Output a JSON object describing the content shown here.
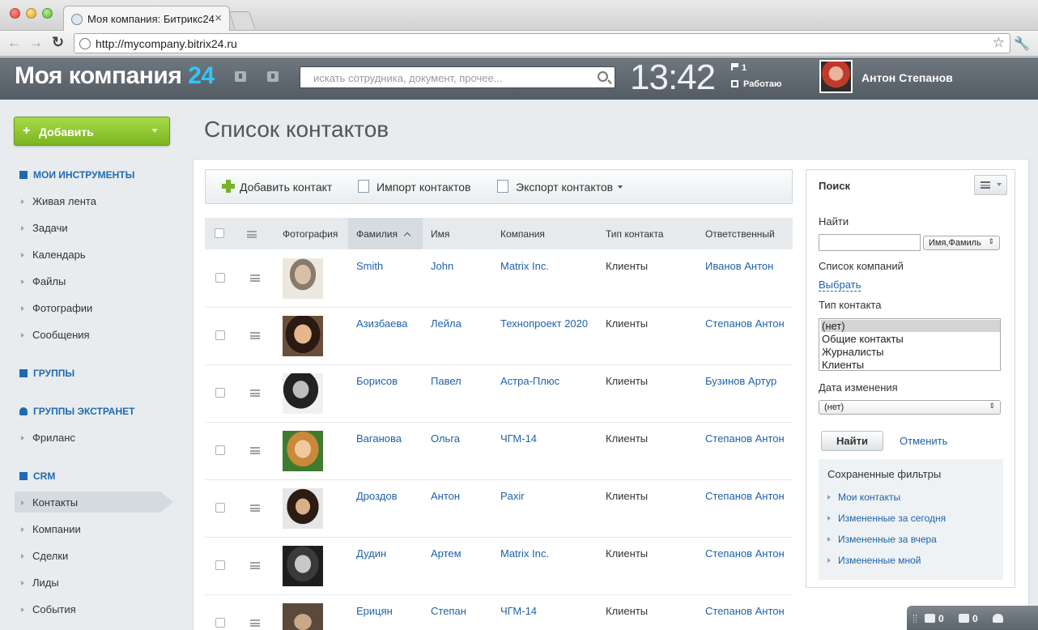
{
  "browser": {
    "tab_title": "Моя компания: Битрикс24",
    "tab_close": "×",
    "url": "http://mycompany.bitrix24.ru",
    "back": "←",
    "forward": "→",
    "reload": "↻",
    "star": "☆",
    "wrench": "🔧"
  },
  "header": {
    "logo_text": "Моя компания",
    "logo_accent": "24",
    "search_placeholder": "искать сотрудника, документ, прочее...",
    "clock": "13:42",
    "flag_count": "1",
    "status": "Работаю",
    "user_name": "Антон Степанов",
    "accent_color": "#2fc7f7"
  },
  "sidebar": {
    "add_plus": "+",
    "add_label": "Добавить",
    "sections": [
      {
        "title": "МОИ ИНСТРУМЕНТЫ",
        "items": [
          "Живая лента",
          "Задачи",
          "Календарь",
          "Файлы",
          "Фотографии",
          "Сообщения"
        ]
      },
      {
        "title": "ГРУППЫ",
        "items": []
      },
      {
        "title": "ГРУППЫ ЭКСТРАНЕТ",
        "items": [
          "Фриланс"
        ]
      },
      {
        "title": "CRM",
        "items": [
          "Контакты",
          "Компании",
          "Сделки",
          "Лиды",
          "События"
        ]
      }
    ],
    "active_item": "Контакты"
  },
  "main": {
    "title": "Список контактов",
    "toolbar": {
      "add_contact": "Добавить контакт",
      "import_contacts": "Импорт контактов",
      "export_contacts": "Экспорт контактов"
    },
    "columns": [
      "Фотография",
      "Фамилия",
      "Имя",
      "Компания",
      "Тип контакта",
      "Ответственный"
    ],
    "rows": [
      {
        "last": "Smith",
        "first": "John",
        "company": "Matrix Inc.",
        "type": "Клиенты",
        "owner": "Иванов Антон"
      },
      {
        "last": "Азизбаева",
        "first": "Лейла",
        "company": "Технопроект 2020",
        "type": "Клиенты",
        "owner": "Степанов Антон"
      },
      {
        "last": "Борисов",
        "first": "Павел",
        "company": "Астра-Плюс",
        "type": "Клиенты",
        "owner": "Бузинов Артур"
      },
      {
        "last": "Ваганова",
        "first": "Ольга",
        "company": "ЧГМ-14",
        "type": "Клиенты",
        "owner": "Степанов Антон"
      },
      {
        "last": "Дроздов",
        "first": "Антон",
        "company": "Paxir",
        "type": "Клиенты",
        "owner": "Степанов Антон"
      },
      {
        "last": "Дудин",
        "first": "Артем",
        "company": "Matrix Inc.",
        "type": "Клиенты",
        "owner": "Степанов Антон"
      },
      {
        "last": "Ерицян",
        "first": "Степан",
        "company": "ЧГМ-14",
        "type": "Клиенты",
        "owner": "Степанов Антон"
      }
    ]
  },
  "filter": {
    "title": "Поиск",
    "find_label": "Найти",
    "find_field_select": "Имя,Фамиль",
    "companies_label": "Список компаний",
    "choose_link": "Выбрать",
    "contact_type_label": "Тип контакта",
    "contact_type_options": [
      "(нет)",
      "Общие контакты",
      "Журналисты",
      "Клиенты"
    ],
    "date_label": "Дата изменения",
    "date_select": "(нет)",
    "find_button": "Найти",
    "cancel_link": "Отменить",
    "saved_title": "Сохраненные фильтры",
    "saved_items": [
      "Мои контакты",
      "Измененные за сегодня",
      "Измененные за вчера",
      "Измененные мной"
    ]
  },
  "bottom_bar": {
    "messages": "0",
    "notifications": "0"
  }
}
